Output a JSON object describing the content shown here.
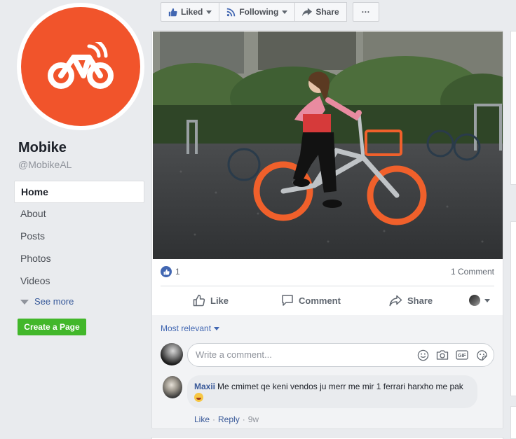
{
  "page": {
    "name": "Mobike",
    "handle": "@MobikeAL",
    "brand_color": "#f1542b"
  },
  "nav": {
    "items": [
      {
        "label": "Home"
      },
      {
        "label": "About"
      },
      {
        "label": "Posts"
      },
      {
        "label": "Photos"
      },
      {
        "label": "Videos"
      }
    ],
    "see_more": "See more"
  },
  "create_page": "Create a Page",
  "toolbar": {
    "liked": "Liked",
    "following": "Following",
    "share": "Share",
    "more": "···"
  },
  "post": {
    "photo_alt": "Woman riding an orange Mobike bicycle",
    "reaction_count": "1",
    "comment_count": "1 Comment",
    "actions": {
      "like": "Like",
      "comment": "Comment",
      "share": "Share"
    }
  },
  "comments": {
    "sort": "Most relevant",
    "placeholder": "Write a comment...",
    "items": [
      {
        "author": "Maxii",
        "text": "Me cmimet qe keni vendos ju merr me mir 1 ferrari harxho me pak",
        "like": "Like",
        "reply": "Reply",
        "time": "9w"
      }
    ]
  },
  "colors": {
    "accent": "#4267b2",
    "link": "#365899",
    "create_button": "#42b72a",
    "background": "#e9ebee"
  }
}
